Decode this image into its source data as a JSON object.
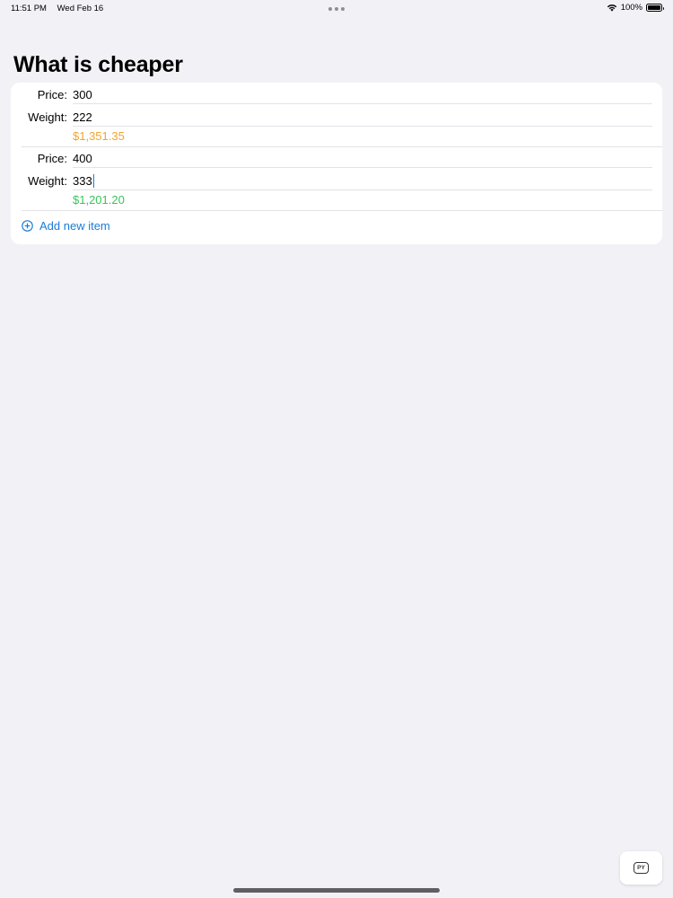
{
  "status_bar": {
    "time": "11:51 PM",
    "date": "Wed Feb 16",
    "battery": "100%",
    "wifi_icon": "wifi-icon",
    "battery_icon": "battery-icon"
  },
  "page": {
    "title": "What is cheaper"
  },
  "items": [
    {
      "price_label": "Price:",
      "price": "300",
      "weight_label": "Weight:",
      "weight": "222",
      "result": "$1,351.35",
      "result_color": "#f0a430"
    },
    {
      "price_label": "Price:",
      "price": "400",
      "weight_label": "Weight:",
      "weight": "333",
      "result": "$1,201.20",
      "result_color": "#34c759"
    }
  ],
  "add_button": {
    "label": "Add new item",
    "icon": "plus-circle-icon",
    "color": "#1a7cd8"
  },
  "keyboard_button": {
    "label": "PY",
    "icon": "keyboard-language-icon"
  }
}
